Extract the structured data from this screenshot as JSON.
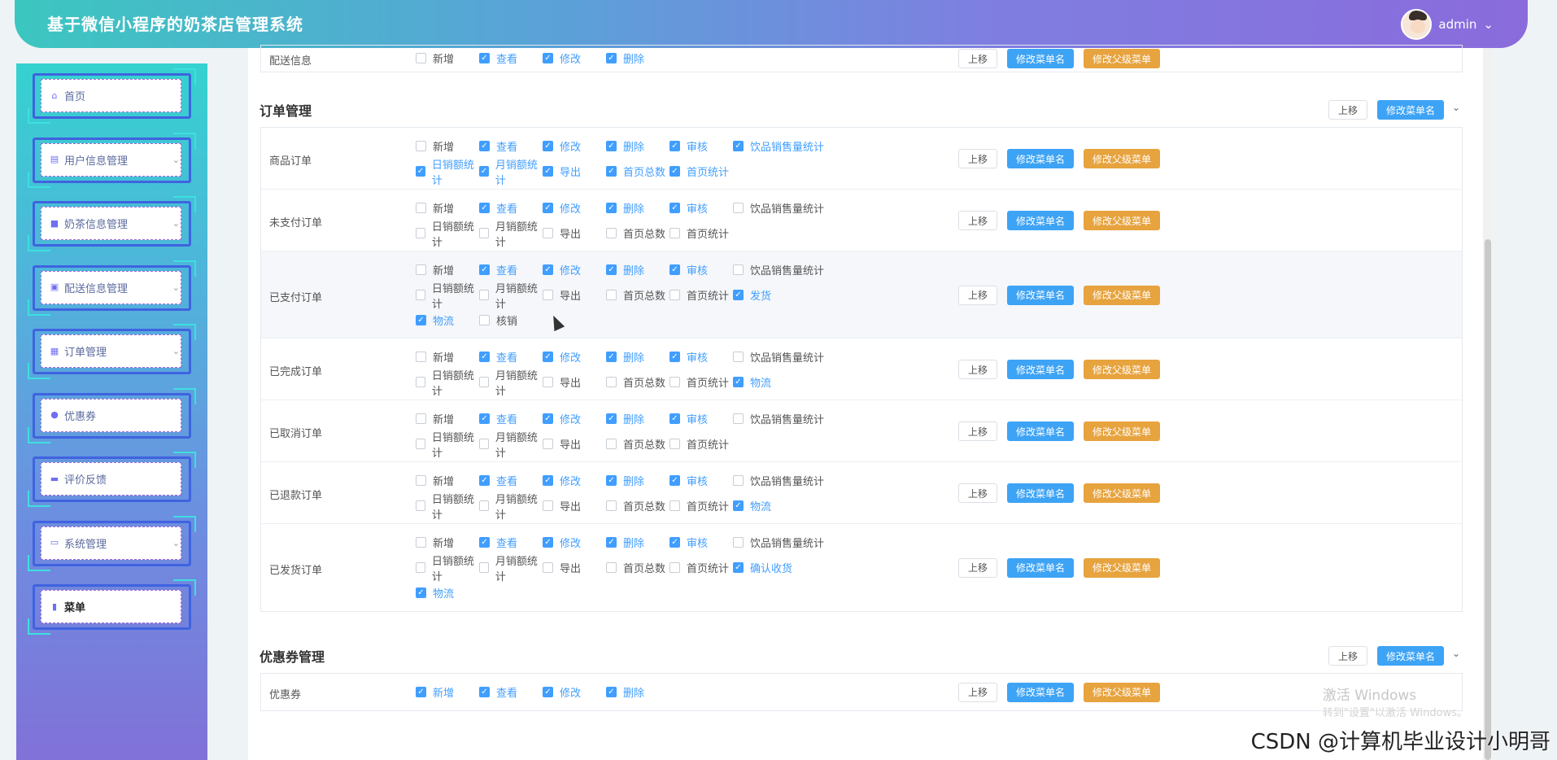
{
  "header": {
    "title": "基于微信小程序的奶茶店管理系统",
    "user": "admin"
  },
  "sidebar": {
    "items": [
      {
        "label": "首页",
        "icon": "home-icon",
        "glyph": "⌂",
        "chev": ""
      },
      {
        "label": "用户信息管理",
        "icon": "list-icon",
        "glyph": "▤",
        "chev": "⌄"
      },
      {
        "label": "奶茶信息管理",
        "icon": "square-icon",
        "glyph": "■",
        "chev": "⌄"
      },
      {
        "label": "配送信息管理",
        "icon": "box-icon",
        "glyph": "▣",
        "chev": "⌄"
      },
      {
        "label": "订单管理",
        "icon": "store-icon",
        "glyph": "▦",
        "chev": "⌄"
      },
      {
        "label": "优惠券",
        "icon": "drop-icon",
        "glyph": "●",
        "chev": ""
      },
      {
        "label": "评价反馈",
        "icon": "bag-icon",
        "glyph": "▬",
        "chev": ""
      },
      {
        "label": "系统管理",
        "icon": "monitor-icon",
        "glyph": "▭",
        "chev": "⌄"
      },
      {
        "label": "菜单",
        "icon": "grid-icon",
        "glyph": "▮",
        "chev": ""
      }
    ]
  },
  "buttons": {
    "up": "上移",
    "rename": "修改菜单名",
    "rename_parent": "修改父级菜单"
  },
  "top_partial": {
    "name": "配送信息",
    "perms": [
      [
        "新增",
        false
      ],
      [
        "查看",
        true
      ],
      [
        "修改",
        true
      ],
      [
        "删除",
        true
      ]
    ]
  },
  "groups": [
    {
      "title": "订单管理",
      "rows": [
        {
          "name": "商品订单",
          "lines": [
            [
              [
                "新增",
                false
              ],
              [
                "查看",
                true
              ],
              [
                "修改",
                true
              ],
              [
                "删除",
                true
              ],
              [
                "审核",
                true
              ],
              [
                "饮品销售量统计",
                true
              ]
            ],
            [
              [
                "日销额统计",
                true
              ],
              [
                "月销额统计",
                true
              ],
              [
                "导出",
                true
              ],
              [
                "首页总数",
                true
              ],
              [
                "首页统计",
                true
              ]
            ]
          ]
        },
        {
          "name": "未支付订单",
          "lines": [
            [
              [
                "新增",
                false
              ],
              [
                "查看",
                true
              ],
              [
                "修改",
                true
              ],
              [
                "删除",
                true
              ],
              [
                "审核",
                true
              ],
              [
                "饮品销售量统计",
                false
              ]
            ],
            [
              [
                "日销额统计",
                false
              ],
              [
                "月销额统计",
                false
              ],
              [
                "导出",
                false
              ],
              [
                "首页总数",
                false
              ],
              [
                "首页统计",
                false
              ]
            ]
          ]
        },
        {
          "name": "已支付订单",
          "hl": true,
          "lines": [
            [
              [
                "新增",
                false
              ],
              [
                "查看",
                true
              ],
              [
                "修改",
                true
              ],
              [
                "删除",
                true
              ],
              [
                "审核",
                true
              ],
              [
                "饮品销售量统计",
                false
              ]
            ],
            [
              [
                "日销额统计",
                false
              ],
              [
                "月销额统计",
                false
              ],
              [
                "导出",
                false
              ],
              [
                "首页总数",
                false
              ],
              [
                "首页统计",
                false
              ],
              [
                "发货",
                true
              ]
            ],
            [
              [
                "物流",
                true
              ],
              [
                "核销",
                false
              ]
            ]
          ]
        },
        {
          "name": "已完成订单",
          "lines": [
            [
              [
                "新增",
                false
              ],
              [
                "查看",
                true
              ],
              [
                "修改",
                true
              ],
              [
                "删除",
                true
              ],
              [
                "审核",
                true
              ],
              [
                "饮品销售量统计",
                false
              ]
            ],
            [
              [
                "日销额统计",
                false
              ],
              [
                "月销额统计",
                false
              ],
              [
                "导出",
                false
              ],
              [
                "首页总数",
                false
              ],
              [
                "首页统计",
                false
              ],
              [
                "物流",
                true
              ]
            ]
          ]
        },
        {
          "name": "已取消订单",
          "lines": [
            [
              [
                "新增",
                false
              ],
              [
                "查看",
                true
              ],
              [
                "修改",
                true
              ],
              [
                "删除",
                true
              ],
              [
                "审核",
                true
              ],
              [
                "饮品销售量统计",
                false
              ]
            ],
            [
              [
                "日销额统计",
                false
              ],
              [
                "月销额统计",
                false
              ],
              [
                "导出",
                false
              ],
              [
                "首页总数",
                false
              ],
              [
                "首页统计",
                false
              ]
            ]
          ]
        },
        {
          "name": "已退款订单",
          "lines": [
            [
              [
                "新增",
                false
              ],
              [
                "查看",
                true
              ],
              [
                "修改",
                true
              ],
              [
                "删除",
                true
              ],
              [
                "审核",
                true
              ],
              [
                "饮品销售量统计",
                false
              ]
            ],
            [
              [
                "日销额统计",
                false
              ],
              [
                "月销额统计",
                false
              ],
              [
                "导出",
                false
              ],
              [
                "首页总数",
                false
              ],
              [
                "首页统计",
                false
              ],
              [
                "物流",
                true
              ]
            ]
          ]
        },
        {
          "name": "已发货订单",
          "lines": [
            [
              [
                "新增",
                false
              ],
              [
                "查看",
                true
              ],
              [
                "修改",
                true
              ],
              [
                "删除",
                true
              ],
              [
                "审核",
                true
              ],
              [
                "饮品销售量统计",
                false
              ]
            ],
            [
              [
                "日销额统计",
                false
              ],
              [
                "月销额统计",
                false
              ],
              [
                "导出",
                false
              ],
              [
                "首页总数",
                false
              ],
              [
                "首页统计",
                false
              ],
              [
                "确认收货",
                true
              ]
            ],
            [
              [
                "物流",
                true
              ]
            ]
          ]
        }
      ]
    },
    {
      "title": "优惠券管理",
      "rows": [
        {
          "name": "优惠券",
          "lines": [
            [
              [
                "新增",
                true
              ],
              [
                "查看",
                true
              ],
              [
                "修改",
                true
              ],
              [
                "删除",
                true
              ]
            ]
          ]
        }
      ]
    }
  ],
  "watermark": {
    "line1": "激活 Windows",
    "line2": "转到\"设置\"以激活 Windows。"
  },
  "csdn": "CSDN @计算机毕业设计小明哥"
}
